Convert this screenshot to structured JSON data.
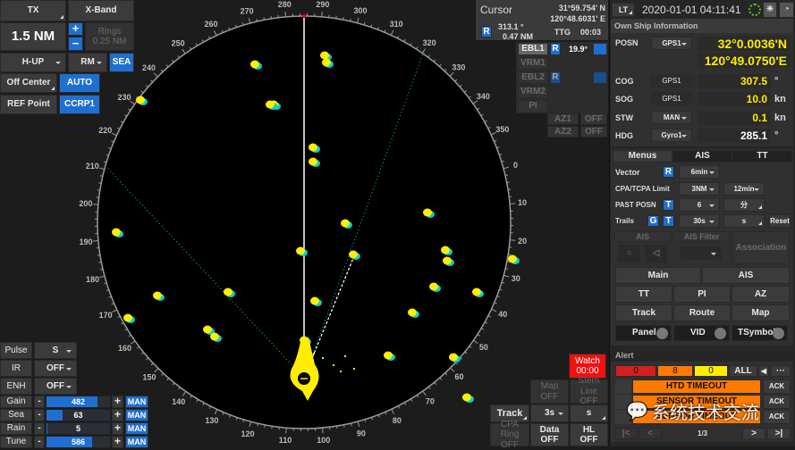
{
  "top_left": {
    "tx": "TX",
    "band": "X-Band",
    "range": "1.5 NM",
    "plus": "+",
    "minus": "−",
    "rings_label": "Rings",
    "rings_value": "0.25 NM",
    "orientation": "H-UP",
    "motion": "RM",
    "sea": "SEA",
    "off_center": "Off Center",
    "auto": "AUTO",
    "ref_point": "REF Point",
    "ccrp": "CCRP1"
  },
  "cursor": {
    "title": "Cursor",
    "lat": "31°59.754' N",
    "lon": "120°48.6031' E",
    "mode": "R",
    "bearing": "313.1 °",
    "distance": "0.47 NM",
    "ttg_label": "TTG",
    "ttg": "00:03"
  },
  "ebl": {
    "ebl1": "EBL1",
    "ebl1_mode": "R",
    "ebl1_value": "19.9°",
    "vrm1": "VRM1",
    "ebl2": "EBL2",
    "ebl2_mode": "R",
    "vrm2": "VRM2",
    "pi": "PI",
    "az1": "AZ1",
    "az1_state": "OFF",
    "az2": "AZ2",
    "az2_state": "OFF"
  },
  "radar": {
    "heading_deg": 285.1,
    "bearing_labels": [
      0,
      10,
      20,
      30,
      40,
      50,
      60,
      70,
      80,
      90,
      100,
      110,
      120,
      130,
      140,
      150,
      160,
      170,
      180,
      190,
      200,
      210,
      220,
      230,
      240,
      250,
      260,
      270,
      280,
      290,
      300,
      310,
      320,
      330,
      340,
      350
    ],
    "colors": {
      "echo": "#ffee00",
      "trail": "#00d0d0",
      "ring": "#9a9a9a"
    }
  },
  "bottom_left": {
    "pulse": {
      "label": "Pulse",
      "value": "S"
    },
    "ir": {
      "label": "IR",
      "value": "OFF"
    },
    "enh": {
      "label": "ENH",
      "value": "OFF"
    },
    "sliders": [
      {
        "label": "Gain",
        "value": "482",
        "level": 0.8,
        "mode": "MAN"
      },
      {
        "label": "Sea",
        "value": "63",
        "level": 0.25,
        "mode": "MAN"
      },
      {
        "label": "Rain",
        "value": "5",
        "level": 0.02,
        "mode": "MAN"
      },
      {
        "label": "Tune",
        "value": "586",
        "level": 0.72,
        "mode": "MAN"
      }
    ],
    "minus": "-",
    "plus": "+"
  },
  "bottom_right": {
    "watch": "Watch",
    "watch_time": "00:00",
    "map": "Map",
    "map_state": "OFF",
    "stern": "Stern",
    "stern_state": "Line OFF",
    "track": "Track",
    "track_interval": "3s",
    "track_unit": "s",
    "cpa_ring": "CPA Ring",
    "cpa_state": "OFF",
    "data": "Data",
    "data_state": "OFF",
    "hl": "HL",
    "hl_state": "OFF"
  },
  "header": {
    "time_mode": "LT",
    "datetime": "2020-01-01 04:11:41"
  },
  "own_ship": {
    "title": "Own Ship Information",
    "posn_label": "POSN",
    "posn_src": "GPS1",
    "lat": "32°0.0036'N",
    "lon": "120°49.0750'E",
    "cog_label": "COG",
    "cog_src": "GPS1",
    "cog": "307.5",
    "cog_unit": "°",
    "sog_label": "SOG",
    "sog_src": "GPS1",
    "sog": "10.0",
    "sog_unit": "kn",
    "stw_label": "STW",
    "stw_src": "MAN",
    "stw": "0.1",
    "stw_unit": "kn",
    "hdg_label": "HDG",
    "hdg_src": "Gyro1",
    "hdg": "285.1",
    "hdg_unit": "°"
  },
  "menus": {
    "tabs": [
      "Menus",
      "AIS",
      "TT"
    ],
    "vector_label": "Vector",
    "vector_mode": "R",
    "vector_value": "6min",
    "cpa_label": "CPA/TCPA Limit",
    "cpa_value": "3NM",
    "tcpa_value": "12min",
    "past_label": "PAST POSN",
    "past_mode": "T",
    "past_value": "6",
    "past_unit": "分",
    "trails_label": "Trails",
    "trails_g": "G",
    "trails_t": "T",
    "trails_value": "30s",
    "trails_unit": "s",
    "reset": "Reset",
    "ais_label": "AIS",
    "ais_filter_label": "AIS Filter",
    "association": "Association",
    "buttons": [
      "Main",
      "AIS",
      "TT",
      "PI",
      "AZ",
      "Track",
      "Route",
      "Map"
    ],
    "toggles": [
      "Panel",
      "VID",
      "TSymbol"
    ]
  },
  "alert": {
    "title": "Alert",
    "counts": [
      "0",
      "8",
      "0"
    ],
    "all": "ALL",
    "more": "···",
    "items": [
      {
        "text": "HTD TIMEOUT",
        "ack": "ACK"
      },
      {
        "text": "SENSOR TIMEOUT",
        "ack": "ACK"
      },
      {
        "text": "SENSOR TIMEOUT",
        "ack": "ACK"
      }
    ],
    "page": "1/3",
    "first": "|<",
    "prev": "<",
    "next": ">",
    "last": ">|",
    "colors": {
      "alarm": "#d42020",
      "warning": "#ff7a00",
      "caution": "#ffee00"
    }
  },
  "watermark": "系统技术交流"
}
